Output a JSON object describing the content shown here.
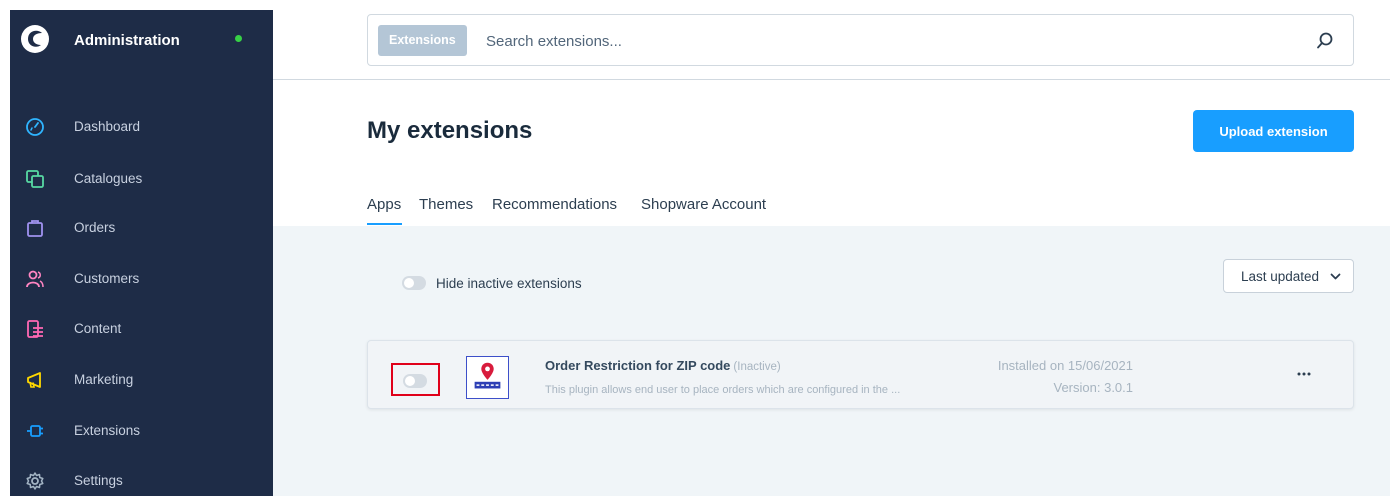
{
  "sidebar": {
    "title": "Administration",
    "status_color": "#37d046",
    "items": [
      {
        "label": "Dashboard",
        "icon": "dashboard-icon",
        "color": "#2fb5ff"
      },
      {
        "label": "Catalogues",
        "icon": "catalogues-icon",
        "color": "#57d9a3"
      },
      {
        "label": "Orders",
        "icon": "orders-icon",
        "color": "#a092f0"
      },
      {
        "label": "Customers",
        "icon": "customers-icon",
        "color": "#ff85c2"
      },
      {
        "label": "Content",
        "icon": "content-icon",
        "color": "#ff68b4"
      },
      {
        "label": "Marketing",
        "icon": "marketing-icon",
        "color": "#ffd700"
      },
      {
        "label": "Extensions",
        "icon": "extensions-icon",
        "color": "#189eff"
      },
      {
        "label": "Settings",
        "icon": "settings-icon",
        "color": "#a3b4c4"
      }
    ]
  },
  "search": {
    "badge": "Extensions",
    "placeholder": "Search extensions..."
  },
  "page": {
    "title": "My extensions",
    "upload_label": "Upload extension"
  },
  "tabs": [
    {
      "label": "Apps",
      "active": true
    },
    {
      "label": "Themes",
      "active": false
    },
    {
      "label": "Recommendations",
      "active": false
    },
    {
      "label": "Shopware Account",
      "active": false
    }
  ],
  "filters": {
    "hide_inactive_label": "Hide inactive extensions",
    "sort_label": "Last updated"
  },
  "extension": {
    "name": "Order Restriction for ZIP code",
    "status": "(Inactive)",
    "description": "This plugin allows end user to place orders which are configured in the ...",
    "installed": "Installed on 15/06/2021",
    "version": "Version: 3.0.1"
  },
  "colors": {
    "sidebar_bg": "#1e2c47",
    "accent": "#189eff",
    "highlight": "#e0001a"
  }
}
